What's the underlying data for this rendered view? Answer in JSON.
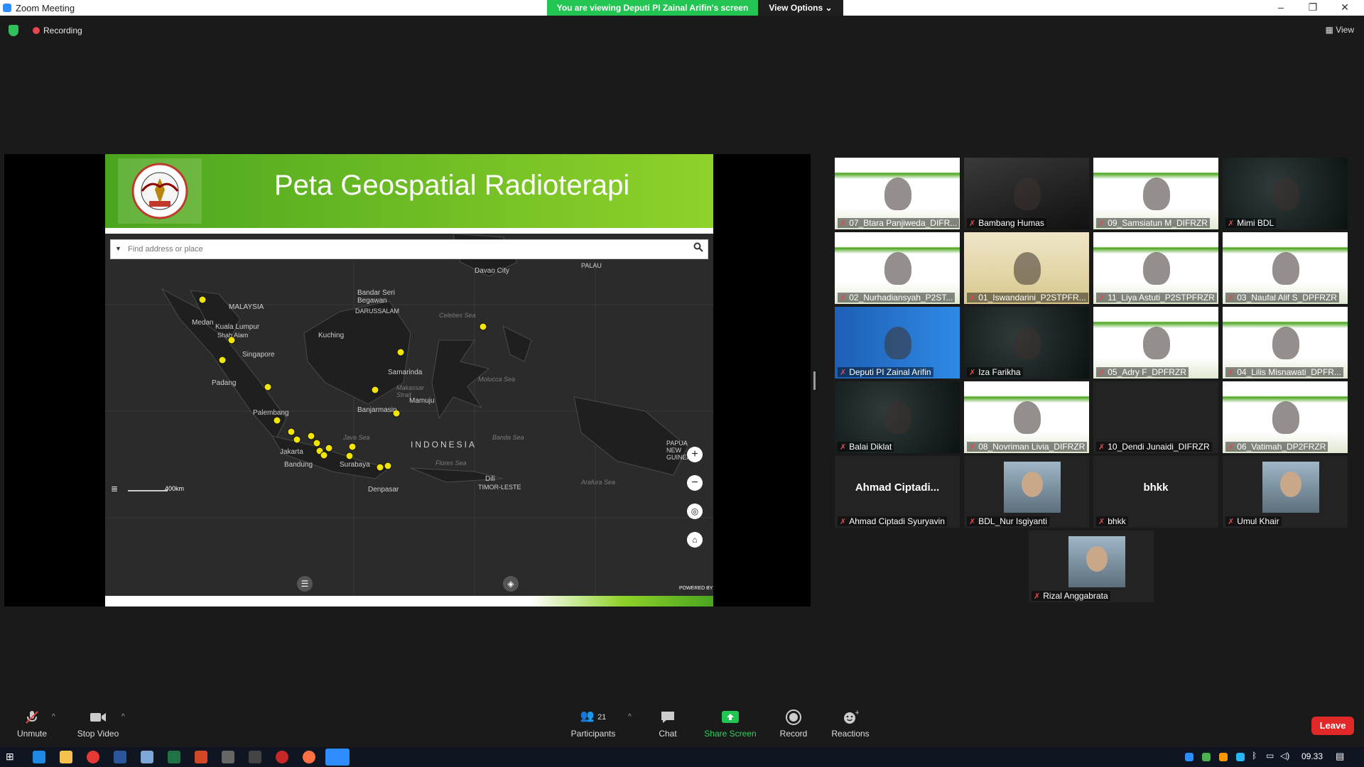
{
  "window": {
    "title": "Zoom Meeting"
  },
  "share_banner": {
    "text": "You are viewing Deputi PI Zainal Arifin's screen",
    "view_options": "View Options"
  },
  "top": {
    "recording": "Recording",
    "view": "View"
  },
  "slide": {
    "title": "Peta Geospatial Radioterapi",
    "search_placeholder": "Find address or place",
    "scale": "400km",
    "map_labels": {
      "malaysia": "MALAYSIA",
      "medan": "Medan",
      "kuala_lumpur": "Kuala Lumpur",
      "shah_alam": "Shah Alam",
      "singapore": "Singapore",
      "padang": "Padang",
      "palembang": "Palembang",
      "jakarta": "Jakarta",
      "bandung": "Bandung",
      "surabaya": "Surabaya",
      "denpasar": "Denpasar",
      "kuching": "Kuching",
      "bandar_seri_begawan": "Bandar Seri Begawan",
      "darussalam": "DARUSSALAM",
      "samarinda": "Samarinda",
      "banjarmasin": "Banjarmasin",
      "mamuju": "Mamuju",
      "indonesia": "INDONESIA",
      "davao_city": "Davao City",
      "palau": "PALAU",
      "dili": "Dili",
      "timor_leste": "TIMOR-LESTE",
      "papua_new_guinea": "PAPUA NEW GUINEA",
      "celebes_sea": "Celebes Sea",
      "makassar_strait": "Makassar Strait",
      "molucca_sea": "Molucca Sea",
      "java_sea": "Java Sea",
      "banda_sea": "Banda Sea",
      "flores_sea": "Flores Sea",
      "arafura_sea": "Arafura Sea"
    },
    "zoom_in": "+",
    "zoom_out": "−",
    "powered_by": "POWERED BY"
  },
  "participants": [
    {
      "name": "07_Btara Panjiweda_DIFR...",
      "bg": "banner"
    },
    {
      "name": "Bambang Humas",
      "bg": "dark"
    },
    {
      "name": "09_Samsiatun M_DIFRZR",
      "bg": "banner"
    },
    {
      "name": "Mimi  BDL",
      "bg": "bdl"
    },
    {
      "name": "02_Nurhadiansyah_P2ST...",
      "bg": "banner"
    },
    {
      "name": "01_Iswandarini_P2STPFR...",
      "bg": "warm"
    },
    {
      "name": "11_Liya Astuti_P2STPFRZR",
      "bg": "banner"
    },
    {
      "name": "03_Naufal Alif S_DPFRZR",
      "bg": "banner"
    },
    {
      "name": "Deputi PI Zainal Arifin",
      "bg": "blue"
    },
    {
      "name": "Iza Farikha",
      "bg": "bdl"
    },
    {
      "name": "05_Adry F_DPFRZR",
      "bg": "banner"
    },
    {
      "name": "04_Lilis Misnawati_DPFR...",
      "bg": "banner"
    },
    {
      "name": "Balai Diklat",
      "bg": "bdl"
    },
    {
      "name": "08_Novriman Livia_DIFRZR",
      "bg": "banner"
    },
    {
      "name": "10_Dendi Junaidi_DIFRZR",
      "bg": "empty"
    },
    {
      "name": "06_Vatimah_DP2FRZR",
      "bg": "banner"
    },
    {
      "name": "Ahmad Ciptadi Syuryavin",
      "big": "Ahmad  Ciptadi...",
      "bg": "empty"
    },
    {
      "name": "BDL_Nur Isgiyanti",
      "bg": "photo"
    },
    {
      "name": "bhkk",
      "big": "bhkk",
      "bg": "empty"
    },
    {
      "name": "Umul Khair",
      "bg": "photo"
    },
    {
      "name": "Rizal Anggabrata",
      "bg": "photo"
    }
  ],
  "toolbar": {
    "unmute": "Unmute",
    "stop_video": "Stop Video",
    "participants": "Participants",
    "participants_count": "21",
    "chat": "Chat",
    "share_screen": "Share Screen",
    "record": "Record",
    "reactions": "Reactions",
    "leave": "Leave"
  },
  "taskbar": {
    "time": "09.33"
  },
  "colors": {
    "zoom_green": "#23c552",
    "leave_red": "#e02828",
    "active_speaker": "#e6d63a",
    "slide_green": "#6cc11f"
  }
}
